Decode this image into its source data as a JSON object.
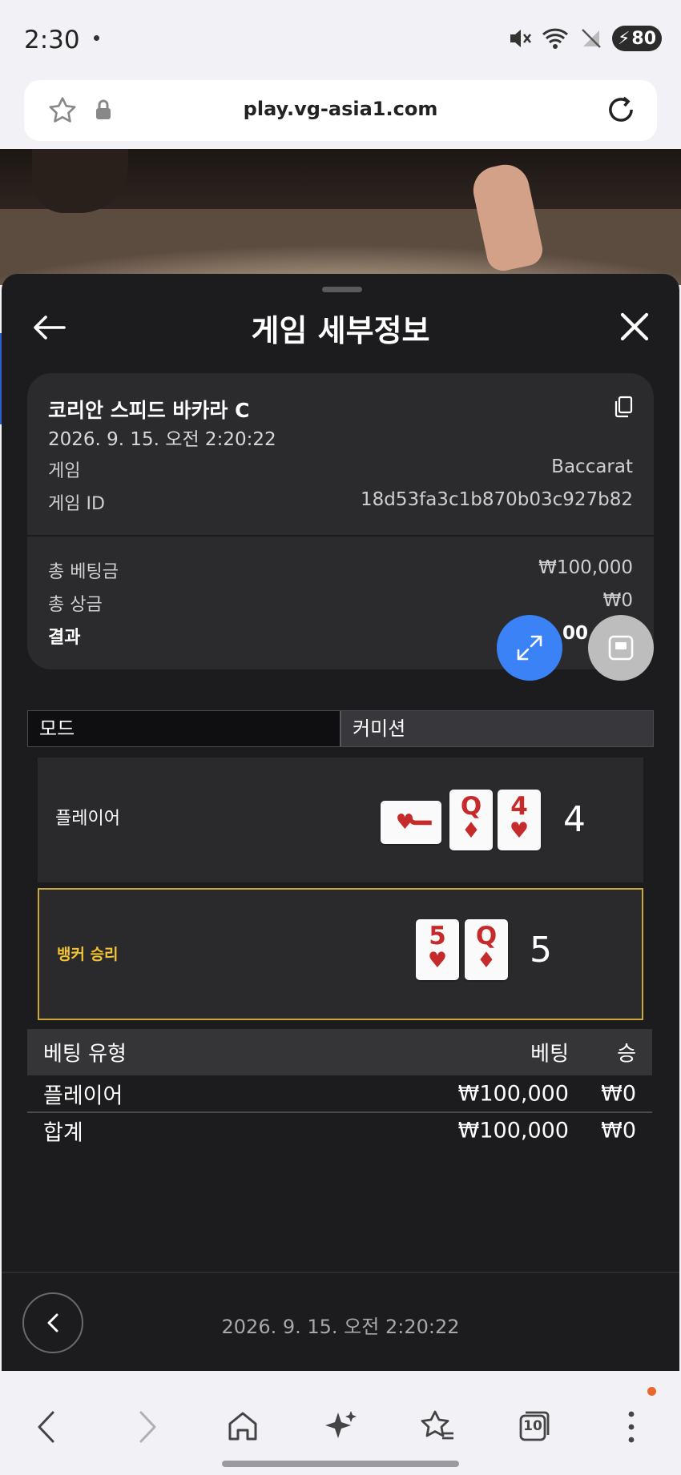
{
  "status_bar": {
    "time": "2:30",
    "battery": "80"
  },
  "browser": {
    "url": "play.vg-asia1.com"
  },
  "panel": {
    "title": "게임 세부정보"
  },
  "game": {
    "name": "코리안 스피드 바카라 C",
    "datetime": "2026. 9. 15. 오전 2:20:22",
    "game_label": "게임",
    "game_value": "Baccarat",
    "game_id_label": "게임 ID",
    "game_id_value": "18d53fa3c1b870b03c927b82"
  },
  "summary": {
    "total_bet_label": "총 베팅금",
    "total_bet_value": "₩100,000",
    "total_win_label": "총 상금",
    "total_win_value": "₩0",
    "result_label": "결과",
    "result_value_partial": "00"
  },
  "tabs": {
    "mode": "모드",
    "commission": "커미션"
  },
  "player": {
    "label": "플레이어",
    "cards": [
      {
        "rank": "J",
        "suit": "♥"
      },
      {
        "rank": "Q",
        "suit": "♦"
      },
      {
        "rank": "4",
        "suit": "♥"
      }
    ],
    "total": "4"
  },
  "banker": {
    "label": "뱅커 승리",
    "cards": [
      {
        "rank": "5",
        "suit": "♥"
      },
      {
        "rank": "Q",
        "suit": "♦"
      }
    ],
    "total": "5"
  },
  "bets": {
    "headers": {
      "type": "베팅 유형",
      "bet": "베팅",
      "win": "승"
    },
    "rows": [
      {
        "type": "플레이어",
        "bet": "₩100,000",
        "win": "₩0"
      }
    ],
    "total": {
      "type": "합계",
      "bet": "₩100,000",
      "win": "₩0"
    }
  },
  "footer": {
    "datetime": "2026. 9. 15. 오전 2:20:22"
  },
  "nav": {
    "tab_count": "10"
  },
  "colors": {
    "accent_blue": "#3b82f6",
    "banker_gold": "#c9a93b",
    "card_red": "#c62b2b"
  }
}
